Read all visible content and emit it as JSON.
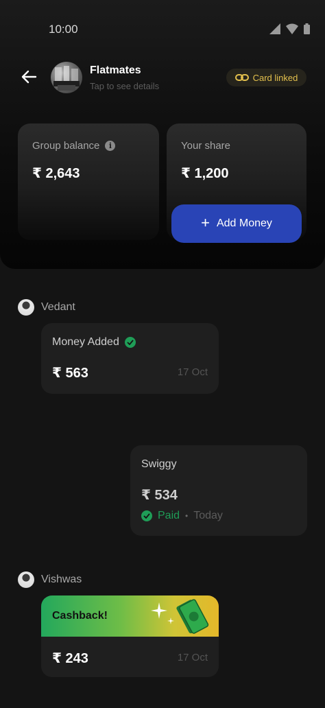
{
  "status_bar": {
    "time": "10:00"
  },
  "header": {
    "group_name": "Flatmates",
    "subtitle": "Tap to see details",
    "card_linked": "Card linked"
  },
  "balance": {
    "group_label": "Group balance",
    "group_value": "₹ 2,643",
    "share_label": "Your share",
    "share_value": "₹ 1,200",
    "add_money": "Add Money"
  },
  "feed": [
    {
      "member": "Vedant",
      "title": "Money Added",
      "amount": "₹ 563",
      "date": "17 Oct"
    },
    {
      "merchant": "Swiggy",
      "amount": "₹ 534",
      "status": "Paid",
      "when": "Today"
    },
    {
      "member": "Vishwas",
      "banner": "Cashback!",
      "amount": "₹ 243",
      "date": "17 Oct"
    }
  ],
  "colors": {
    "accent_blue": "#2944b6",
    "gold": "#e3c04d",
    "success_green": "#1f9d57",
    "background": "#141414",
    "card": "#1f1f1f"
  },
  "icons": [
    "signal-icon",
    "wifi-icon",
    "battery-icon",
    "back-arrow-icon",
    "link-icon",
    "info-icon",
    "plus-icon",
    "check-icon",
    "sparkle-icon",
    "cash-icon"
  ]
}
